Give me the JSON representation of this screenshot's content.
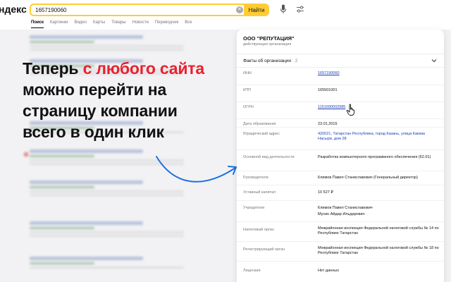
{
  "header": {
    "logo": "ндекс",
    "search_value": "1657190060",
    "search_button": "Найти",
    "tabs": [
      "Поиск",
      "Картинки",
      "Видео",
      "Карты",
      "Товары",
      "Новости",
      "Переводчик",
      "Все"
    ]
  },
  "hero": {
    "line1_start": "Теперь ",
    "line1_accent": "с любого сайта",
    "line2": "можно перейти на",
    "line3": "страницу компании",
    "line4": "всего в один клик"
  },
  "card": {
    "title": "ООО \"РЕПУТАЦИЯ\"",
    "subtitle": "действующая организация",
    "facts_label": "Факты об организации",
    "facts_count": "· 2",
    "rows": [
      {
        "label": "ИНН",
        "value": "1657190060"
      },
      {
        "label": "КПП",
        "value": "165501001"
      },
      {
        "label": "ОГРН",
        "value": "1151690002985"
      },
      {
        "label": "Дата образования",
        "value": "23.01.2015"
      },
      {
        "label": "Юридический адрес",
        "value": "420021, Татарстан Республика, город Казань, улица Каюма Насыри, дом 28"
      },
      {
        "label": "Основной вид деятельности",
        "value": "Разработка компьютерного программного обеспечения (62.01)"
      },
      {
        "label": "Руководители",
        "value": "Климов Павел Станиславович (Генеральный директор)"
      },
      {
        "label": "Уставный капитал",
        "value": "10 527 ₽"
      },
      {
        "label": "Учредители",
        "value": "Климов Павел Станиславович",
        "value2": "Мусин Айдар Ильдарович"
      },
      {
        "label": "Налоговый орган",
        "value": "Межрайонная инспекция Федеральной налоговой службы № 14 по Республике Татарстан"
      },
      {
        "label": "Регистрирующий орган",
        "value": "Межрайонная инспекция Федеральной налоговой службы № 18 по Республике Татарстан"
      },
      {
        "label": "Лицензии",
        "value": "Нет данных"
      }
    ]
  },
  "colors": {
    "accent_red": "#e8222d",
    "search_yellow": "#ffcc33",
    "link_blue": "#1a3fb5",
    "arrow_blue": "#1f6fe0"
  }
}
